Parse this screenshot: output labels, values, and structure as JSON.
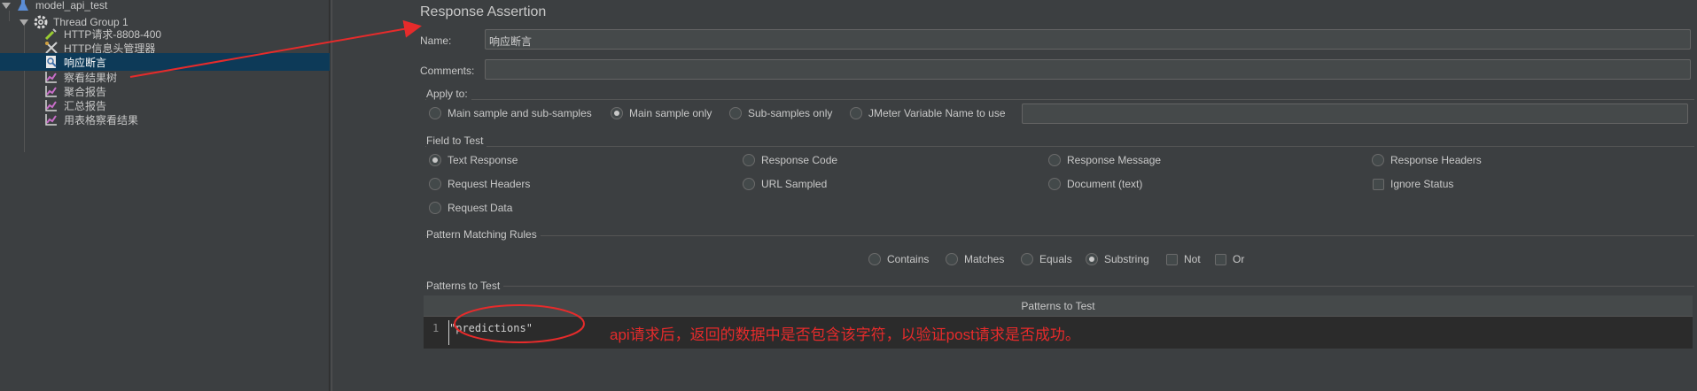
{
  "tree": {
    "items": [
      {
        "label": "model_api_test",
        "icon": "flask-icon"
      },
      {
        "label": "Thread Group 1",
        "icon": "gear-icon"
      },
      {
        "label": "HTTP请求-8808-400",
        "icon": "pipette-icon"
      },
      {
        "label": "HTTP信息头管理器",
        "icon": "tools-icon"
      },
      {
        "label": "响应断言",
        "icon": "assertion-icon"
      },
      {
        "label": "察看结果树",
        "icon": "graph-icon"
      },
      {
        "label": "聚合报告",
        "icon": "graph-icon"
      },
      {
        "label": "汇总报告",
        "icon": "graph-icon"
      },
      {
        "label": "用表格察看结果",
        "icon": "graph-icon"
      }
    ],
    "selected": "响应断言"
  },
  "panel": {
    "title": "Response Assertion",
    "name_label": "Name:",
    "name_value": "响应断言",
    "comments_label": "Comments:",
    "comments_value": "",
    "apply_to": {
      "title": "Apply to:",
      "options": [
        "Main sample and sub-samples",
        "Main sample only",
        "Sub-samples only",
        "JMeter Variable Name to use"
      ],
      "selected": "Main sample only",
      "variable_value": ""
    },
    "field_to_test": {
      "title": "Field to Test",
      "options": [
        "Text Response",
        "Response Code",
        "Response Message",
        "Response Headers",
        "Request Headers",
        "URL Sampled",
        "Document (text)",
        "Request Data"
      ],
      "selected": "Text Response",
      "ignore_status_label": "Ignore Status",
      "ignore_status_checked": false
    },
    "pattern_rules": {
      "title": "Pattern Matching Rules",
      "options": [
        "Contains",
        "Matches",
        "Equals",
        "Substring"
      ],
      "selected": "Substring",
      "not_label": "Not",
      "not_checked": false,
      "or_label": "Or",
      "or_checked": false
    },
    "patterns": {
      "title": "Patterns to Test",
      "column_header": "Patterns to Test",
      "rows": [
        {
          "line": "1",
          "value": "\"predictions\""
        }
      ]
    }
  },
  "annotation": {
    "text": "api请求后，返回的数据中是否包含该字符，以验证post请求是否成功。",
    "color": "#e62b2b"
  }
}
